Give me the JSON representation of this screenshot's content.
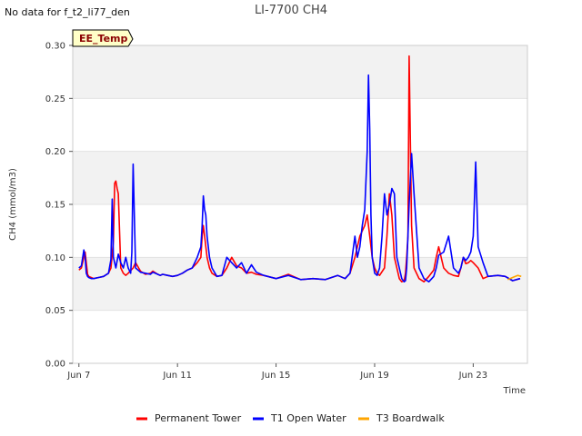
{
  "header": {
    "no_data_text": "No data for f_t2_li77_den",
    "title": "LI-7700 CH4"
  },
  "badge": {
    "label": "EE_Temp"
  },
  "chart_data": {
    "type": "line",
    "title": "LI-7700 CH4",
    "xlabel": "Time",
    "ylabel": "CH4 (mmol/m3)",
    "xlim": [
      6.75,
      25.2
    ],
    "ylim": [
      0.0,
      0.3
    ],
    "x_unit": "day of June",
    "x_ticks": [
      {
        "value": 7,
        "label": "Jun 7"
      },
      {
        "value": 11,
        "label": "Jun 11"
      },
      {
        "value": 15,
        "label": "Jun 15"
      },
      {
        "value": 19,
        "label": "Jun 19"
      },
      {
        "value": 23,
        "label": "Jun 23"
      }
    ],
    "y_ticks": [
      {
        "value": 0.0,
        "label": "0.00"
      },
      {
        "value": 0.05,
        "label": "0.05"
      },
      {
        "value": 0.1,
        "label": "0.10"
      },
      {
        "value": 0.15,
        "label": "0.15"
      },
      {
        "value": 0.2,
        "label": "0.20"
      },
      {
        "value": 0.25,
        "label": "0.25"
      },
      {
        "value": 0.3,
        "label": "0.30"
      }
    ],
    "grid": true,
    "legend_position": "bottom",
    "series": [
      {
        "name": "Permanent Tower",
        "color": "#ff0000",
        "x": [
          7.0,
          7.1,
          7.2,
          7.25,
          7.3,
          7.35,
          7.4,
          7.5,
          7.6,
          7.8,
          8.0,
          8.2,
          8.3,
          8.4,
          8.45,
          8.5,
          8.55,
          8.6,
          8.7,
          8.8,
          8.9,
          9.0,
          9.2,
          9.3,
          9.5,
          9.7,
          9.9,
          10.0,
          10.2,
          10.3,
          10.4,
          10.6,
          10.8,
          11.0,
          11.2,
          11.4,
          11.6,
          11.8,
          11.95,
          12.0,
          12.05,
          12.1,
          12.2,
          12.3,
          12.4,
          12.6,
          12.8,
          13.0,
          13.2,
          13.4,
          13.6,
          13.8,
          14.0,
          14.2,
          14.5,
          15.0,
          15.5,
          16.0,
          16.5,
          17.0,
          17.5,
          17.8,
          18.0,
          18.2,
          18.3,
          18.4,
          18.5,
          18.6,
          18.7,
          18.8,
          18.9,
          19.0,
          19.1,
          19.2,
          19.4,
          19.5,
          19.6,
          19.7,
          19.8,
          19.9,
          20.0,
          20.1,
          20.2,
          20.25,
          20.3,
          20.35,
          20.4,
          20.5,
          20.6,
          20.8,
          21.0,
          21.2,
          21.4,
          21.5,
          21.6,
          21.8,
          22.0,
          22.2,
          22.4,
          22.5,
          22.6,
          22.7,
          22.8,
          22.9,
          23.0,
          23.2,
          23.4,
          23.6,
          24.0,
          24.3,
          24.6,
          24.9
        ],
        "y": [
          0.088,
          0.09,
          0.1,
          0.105,
          0.095,
          0.084,
          0.082,
          0.081,
          0.08,
          0.081,
          0.082,
          0.085,
          0.09,
          0.115,
          0.17,
          0.172,
          0.165,
          0.16,
          0.09,
          0.085,
          0.083,
          0.085,
          0.09,
          0.095,
          0.087,
          0.084,
          0.085,
          0.087,
          0.084,
          0.083,
          0.084,
          0.083,
          0.082,
          0.083,
          0.085,
          0.088,
          0.09,
          0.095,
          0.1,
          0.12,
          0.13,
          0.12,
          0.1,
          0.09,
          0.085,
          0.082,
          0.083,
          0.09,
          0.1,
          0.092,
          0.09,
          0.085,
          0.086,
          0.084,
          0.083,
          0.08,
          0.084,
          0.079,
          0.08,
          0.079,
          0.083,
          0.08,
          0.085,
          0.1,
          0.11,
          0.12,
          0.125,
          0.13,
          0.14,
          0.12,
          0.1,
          0.09,
          0.085,
          0.083,
          0.09,
          0.12,
          0.16,
          0.14,
          0.1,
          0.09,
          0.08,
          0.077,
          0.078,
          0.085,
          0.1,
          0.12,
          0.29,
          0.13,
          0.09,
          0.08,
          0.077,
          0.082,
          0.088,
          0.1,
          0.11,
          0.09,
          0.085,
          0.083,
          0.082,
          0.09,
          0.1,
          0.094,
          0.095,
          0.097,
          0.095,
          0.09,
          0.08,
          0.082,
          0.083,
          0.082,
          0.078,
          0.08
        ]
      },
      {
        "name": "T1 Open Water",
        "color": "#0000ff",
        "x": [
          7.0,
          7.1,
          7.2,
          7.25,
          7.3,
          7.35,
          7.4,
          7.5,
          7.6,
          7.8,
          8.0,
          8.2,
          8.3,
          8.35,
          8.4,
          8.5,
          8.6,
          8.7,
          8.8,
          8.9,
          9.0,
          9.1,
          9.15,
          9.2,
          9.3,
          9.5,
          9.7,
          9.9,
          10.0,
          10.2,
          10.3,
          10.4,
          10.6,
          10.8,
          11.0,
          11.2,
          11.4,
          11.6,
          11.8,
          11.95,
          12.0,
          12.05,
          12.1,
          12.15,
          12.2,
          12.3,
          12.4,
          12.6,
          12.8,
          13.0,
          13.2,
          13.4,
          13.6,
          13.8,
          14.0,
          14.2,
          14.5,
          15.0,
          15.5,
          16.0,
          16.5,
          17.0,
          17.5,
          17.8,
          18.0,
          18.2,
          18.3,
          18.4,
          18.5,
          18.6,
          18.7,
          18.75,
          18.8,
          18.85,
          18.9,
          19.0,
          19.1,
          19.2,
          19.3,
          19.4,
          19.5,
          19.6,
          19.7,
          19.8,
          19.9,
          20.0,
          20.1,
          20.2,
          20.25,
          20.3,
          20.35,
          20.4,
          20.5,
          20.6,
          20.8,
          21.0,
          21.2,
          21.4,
          21.5,
          21.6,
          21.8,
          22.0,
          22.2,
          22.4,
          22.5,
          22.6,
          22.7,
          22.8,
          22.9,
          23.0,
          23.1,
          23.2,
          23.4,
          23.6,
          24.0,
          24.3,
          24.6,
          24.9
        ],
        "y": [
          0.09,
          0.092,
          0.107,
          0.1,
          0.085,
          0.082,
          0.081,
          0.08,
          0.08,
          0.081,
          0.082,
          0.085,
          0.098,
          0.155,
          0.1,
          0.09,
          0.103,
          0.095,
          0.09,
          0.1,
          0.09,
          0.085,
          0.105,
          0.188,
          0.09,
          0.086,
          0.085,
          0.084,
          0.086,
          0.084,
          0.083,
          0.084,
          0.083,
          0.082,
          0.083,
          0.085,
          0.088,
          0.09,
          0.1,
          0.11,
          0.13,
          0.158,
          0.145,
          0.14,
          0.12,
          0.1,
          0.09,
          0.082,
          0.083,
          0.1,
          0.095,
          0.09,
          0.095,
          0.085,
          0.093,
          0.086,
          0.083,
          0.08,
          0.083,
          0.079,
          0.08,
          0.079,
          0.083,
          0.08,
          0.085,
          0.12,
          0.1,
          0.11,
          0.13,
          0.145,
          0.2,
          0.272,
          0.22,
          0.14,
          0.1,
          0.085,
          0.083,
          0.09,
          0.12,
          0.16,
          0.14,
          0.15,
          0.165,
          0.16,
          0.1,
          0.09,
          0.08,
          0.077,
          0.078,
          0.09,
          0.12,
          0.15,
          0.198,
          0.16,
          0.09,
          0.08,
          0.077,
          0.082,
          0.09,
          0.102,
          0.105,
          0.12,
          0.09,
          0.085,
          0.09,
          0.1,
          0.097,
          0.1,
          0.105,
          0.12,
          0.19,
          0.11,
          0.095,
          0.082,
          0.083,
          0.082,
          0.078,
          0.08
        ]
      },
      {
        "name": "T3 Boardwalk",
        "color": "#ffa500",
        "x": [
          24.4,
          24.6,
          24.8,
          24.95
        ],
        "y": [
          0.079,
          0.081,
          0.083,
          0.082
        ]
      }
    ]
  }
}
